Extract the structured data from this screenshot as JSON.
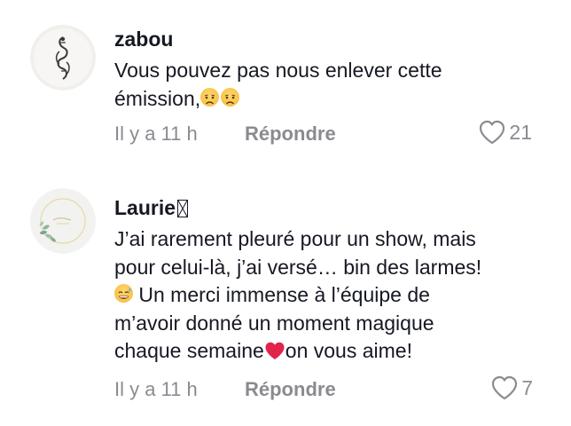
{
  "comments": [
    {
      "username": "zabou",
      "text_line1": "Vous pouvez pas nous enlever cette",
      "text_line2": "émission,",
      "emojis": [
        "disappointed-face",
        "disappointed-face"
      ],
      "timestamp": "Il y a 11 h",
      "reply_label": "Répondre",
      "like_count": "21"
    },
    {
      "username": "Laurie",
      "username_suffix": "",
      "text_line1": "J’ai rarement pleuré pour un show, mais",
      "text_line2": "pour celui-là, j’ai versé… bin des larmes!",
      "text_line3": " Un merci immense à l’équipe de",
      "text_line4": "m’avoir donné un moment magique",
      "text_line5a": "chaque semaine",
      "text_line5b": "on vous aime!",
      "emojis": [
        "grinning-sweat-face",
        "red-heart"
      ],
      "timestamp": "Il y a 11 h",
      "reply_label": "Répondre",
      "like_count": "7"
    }
  ],
  "colors": {
    "text": "#161823",
    "secondary": "#8a8b91",
    "heart_emoji": "#e0244a"
  }
}
